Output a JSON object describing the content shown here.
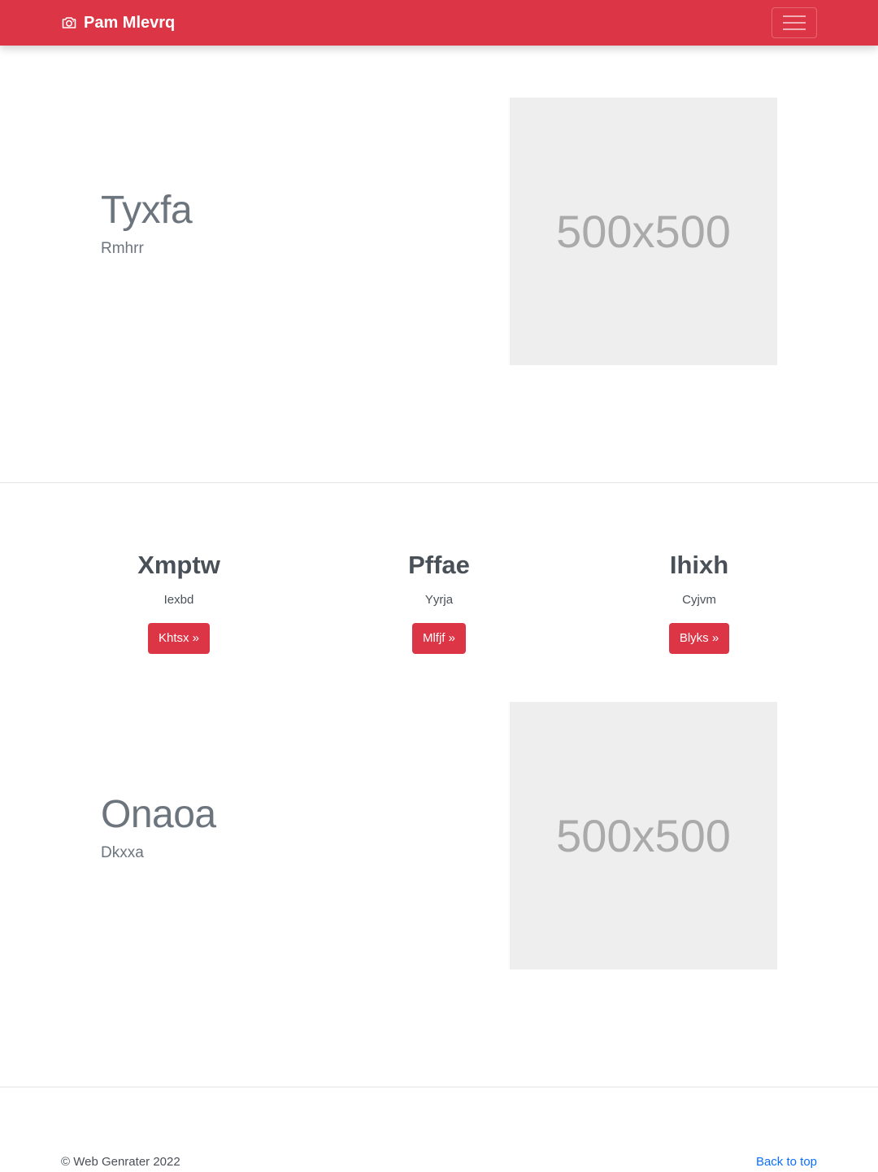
{
  "colors": {
    "brand": "#dc3545",
    "muted": "#6c757d",
    "link": "#0d6efd",
    "placeholder_bg": "#eeeeee"
  },
  "navbar": {
    "brand_icon": "camera-icon",
    "brand": "Pam Mlevrq",
    "toggler_icon": "hamburger-menu-icon"
  },
  "features": [
    {
      "title": "Tyxfa",
      "subtitle": "Rmhrr",
      "image_label": "500x500"
    },
    {
      "title": "Onaoa",
      "subtitle": "Dkxxa",
      "image_label": "500x500"
    }
  ],
  "columns": [
    {
      "heading": "Xmptw",
      "text": "Iexbd",
      "button": "Khtsx »"
    },
    {
      "heading": "Pffae",
      "text": "Yyrja",
      "button": "Mlfjf »"
    },
    {
      "heading": "Ihixh",
      "text": "Cyjvm",
      "button": "Blyks »"
    }
  ],
  "footer": {
    "copyright": "© Web Genrater 2022",
    "back_to_top": "Back to top"
  }
}
